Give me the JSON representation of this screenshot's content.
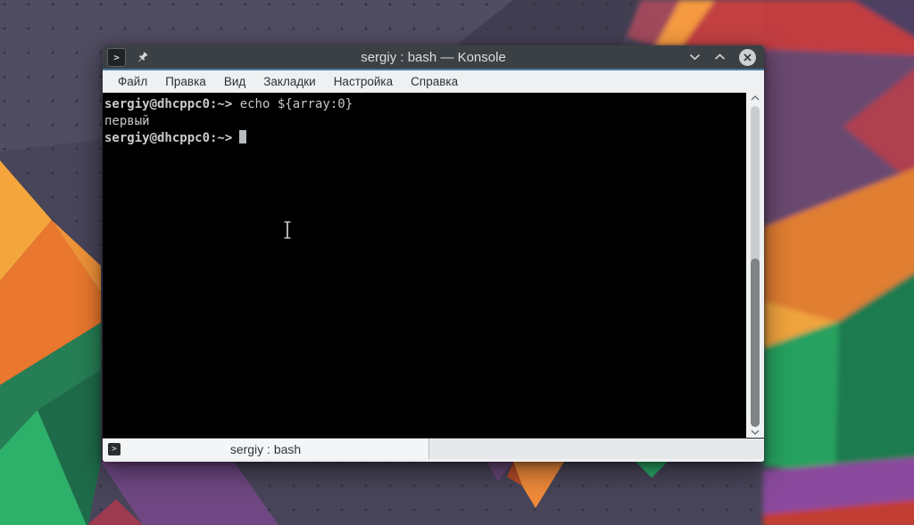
{
  "window": {
    "title": "sergiy : bash — Konsole",
    "app_icon_glyph": ">",
    "controls": {
      "minimize_icon": "chevron-down",
      "maximize_icon": "chevron-up",
      "close_icon": "x-in-circle"
    }
  },
  "menubar": {
    "items": [
      "Файл",
      "Правка",
      "Вид",
      "Закладки",
      "Настройка",
      "Справка"
    ]
  },
  "terminal": {
    "prompt": "sergiy@dhcppc0:~>",
    "command": "echo ${array:0}",
    "output": "первый"
  },
  "tabbar": {
    "active_tab_label": "sergiy : bash",
    "tab_icon_glyph": ">"
  },
  "colors": {
    "titlebar": "#3b4045",
    "accent_line": "#4579a0",
    "menubar_bg": "#eff0f1",
    "terminal_bg": "#000000",
    "terminal_fg": "#c7c7c7",
    "wallpaper_base": "#484459"
  }
}
